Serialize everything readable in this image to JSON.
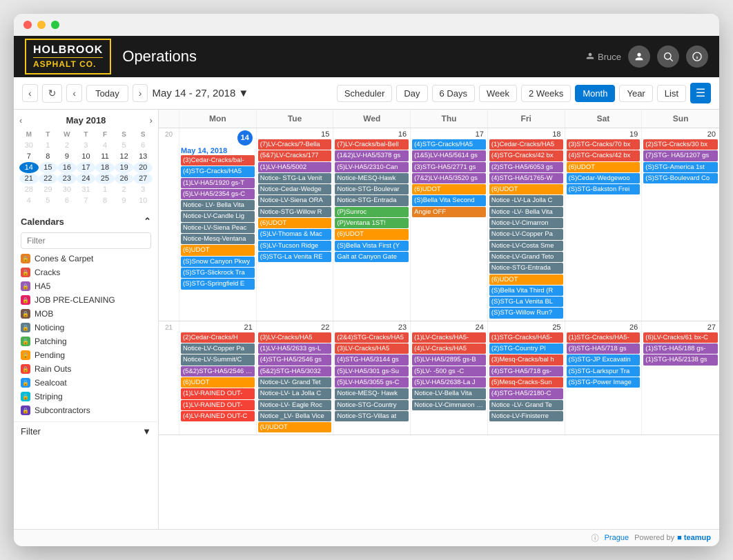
{
  "app": {
    "title": "Operations",
    "logo_line1": "HOLBROOK",
    "logo_line2": "ASPHALT CO.",
    "user_name": "Bruce"
  },
  "toolbar": {
    "today_label": "Today",
    "date_range": "May 14 - 27, 2018",
    "scheduler_label": "Scheduler",
    "day_label": "Day",
    "six_days_label": "6 Days",
    "week_label": "Week",
    "two_weeks_label": "2 Weeks",
    "month_label": "Month",
    "year_label": "Year",
    "list_label": "List"
  },
  "mini_cal": {
    "month_year": "May 2018",
    "days_of_week": [
      "M",
      "T",
      "W",
      "T",
      "F",
      "S",
      "S"
    ],
    "weeks": [
      [
        "30",
        "1",
        "2",
        "3",
        "4",
        "5",
        "6"
      ],
      [
        "7",
        "8",
        "9",
        "10",
        "11",
        "12",
        "13"
      ],
      [
        "14",
        "15",
        "16",
        "17",
        "18",
        "19",
        "20"
      ],
      [
        "21",
        "22",
        "23",
        "24",
        "25",
        "26",
        "27"
      ],
      [
        "28",
        "29",
        "30",
        "31",
        "1",
        "2",
        "3"
      ],
      [
        "4",
        "5",
        "6",
        "7",
        "8",
        "9",
        "10"
      ]
    ]
  },
  "calendars": {
    "header": "Calendars",
    "filter_placeholder": "Filter",
    "items": [
      {
        "label": "Cones & Carpet",
        "color": "#e67e22"
      },
      {
        "label": "Cracks",
        "color": "#e74c3c"
      },
      {
        "label": "HA5",
        "color": "#9b59b6"
      },
      {
        "label": "JOB PRE-CLEANING",
        "color": "#e91e63"
      },
      {
        "label": "MOB",
        "color": "#795548"
      },
      {
        "label": "Noticing",
        "color": "#607d8b"
      },
      {
        "label": "Patching",
        "color": "#4caf50"
      },
      {
        "label": "Pending",
        "color": "#ff9800"
      },
      {
        "label": "Rain Outs",
        "color": "#f44336"
      },
      {
        "label": "Sealcoat",
        "color": "#2196f3"
      },
      {
        "label": "Striping",
        "color": "#00bcd4"
      },
      {
        "label": "Subcontractors",
        "color": "#673ab7"
      }
    ],
    "filter_label": "Filter"
  },
  "calendar": {
    "col_header": "Mon",
    "week_days": [
      "Mon",
      "Tue",
      "Wed",
      "Thu",
      "Fri",
      "Sat",
      "Sun"
    ],
    "weeks": [
      {
        "week_num": 20,
        "days": [
          {
            "date": "14",
            "is_today": true,
            "label": "May 14, 2018",
            "events": [
              {
                "text": "(3)Cedar-Cracks/bal-",
                "color": "#e74c3c"
              },
              {
                "text": "(4)STG-Cracks/HA5",
                "color": "#2196f3"
              },
              {
                "text": "(1)LV-HA5/1920 gs-T",
                "color": "#9b59b6"
              },
              {
                "text": "(5)LV-HA5/2354 gs-C",
                "color": "#9b59b6"
              },
              {
                "text": "Notice- LV- Bella Vita",
                "color": "#607d8b"
              },
              {
                "text": "Notice-LV-Candle Lig",
                "color": "#607d8b"
              },
              {
                "text": "Notice-LV-Siena Peac",
                "color": "#607d8b"
              },
              {
                "text": "Notice-Mesq-Ventana",
                "color": "#607d8b"
              },
              {
                "text": "(6)UDOT",
                "color": "#ff9800"
              },
              {
                "text": "(S)Snow Canyon Pkwy",
                "color": "#2196f3"
              },
              {
                "text": "(S)STG-Slickrock Tra",
                "color": "#2196f3"
              },
              {
                "text": "(S)STG-Springfield E",
                "color": "#2196f3"
              }
            ]
          },
          {
            "date": "15",
            "events": [
              {
                "text": "(7)LV-Cracks/?-Bella",
                "color": "#e74c3c"
              },
              {
                "text": "(5&7)LV-Cracks/177",
                "color": "#e74c3c"
              },
              {
                "text": "(1)LV-HA5/5002",
                "color": "#9b59b6"
              },
              {
                "text": "Notice- STG-La Venit",
                "color": "#607d8b"
              },
              {
                "text": "Notice-Cedar-Wedge",
                "color": "#607d8b"
              },
              {
                "text": "Notice-LV-Siena ORA",
                "color": "#607d8b"
              },
              {
                "text": "Notice-STG-Willow R",
                "color": "#607d8b"
              },
              {
                "text": "(6)UDOT",
                "color": "#ff9800"
              },
              {
                "text": "(S)LV-Thomas & Mac",
                "color": "#2196f3"
              },
              {
                "text": "(S)LV-Tucson Ridge",
                "color": "#2196f3"
              },
              {
                "text": "(S)STG-La Venita RE",
                "color": "#2196f3"
              }
            ]
          },
          {
            "date": "16",
            "events": [
              {
                "text": "(7)LV-Cracks/bal-Bell",
                "color": "#e74c3c"
              },
              {
                "text": "(1&2)LV-HA5/5378 gs",
                "color": "#9b59b6"
              },
              {
                "text": "(5)LV-HA5/2310-Can",
                "color": "#9b59b6"
              },
              {
                "text": "Notice-MESQ-Hawk",
                "color": "#607d8b"
              },
              {
                "text": "Notice-STG-Boulevar",
                "color": "#607d8b"
              },
              {
                "text": "Notice-STG-Entrada",
                "color": "#607d8b"
              },
              {
                "text": "(P)Sunroc",
                "color": "#4caf50"
              },
              {
                "text": "(P)Ventana 1ST!",
                "color": "#4caf50"
              },
              {
                "text": "(6)UDOT",
                "color": "#ff9800"
              },
              {
                "text": "(S)Bella Vista First (Y",
                "color": "#2196f3"
              },
              {
                "text": "Galt at Canyon Gate",
                "color": "#2196f3"
              }
            ]
          },
          {
            "date": "17",
            "events": [
              {
                "text": "(4)STG-Cracks/HA5",
                "color": "#2196f3"
              },
              {
                "text": "(1&5)LV-HA5/5614 gs",
                "color": "#9b59b6"
              },
              {
                "text": "(3)STG-HA5/2771 gs",
                "color": "#9b59b6"
              },
              {
                "text": "(7&2)LV-HA5/3520 gs",
                "color": "#9b59b6"
              },
              {
                "text": "(6)UDOT",
                "color": "#ff9800"
              },
              {
                "text": "(S)Bella Vita Second",
                "color": "#2196f3"
              },
              {
                "text": "Angie OFF",
                "color": "#e67e22"
              }
            ]
          },
          {
            "date": "18",
            "events": [
              {
                "text": "(1)Cedar-Cracks/HA5",
                "color": "#e74c3c"
              },
              {
                "text": "(4)STG-Cracks/42 bx",
                "color": "#e74c3c"
              },
              {
                "text": "(2)STG-HA5/6053 gs",
                "color": "#9b59b6"
              },
              {
                "text": "(4)STG-HA5/1765-W",
                "color": "#9b59b6"
              },
              {
                "text": "(6)UDOT",
                "color": "#ff9800"
              },
              {
                "text": "Notice -LV-La Jolla C",
                "color": "#607d8b"
              },
              {
                "text": "Notice -LV- Bella Vita",
                "color": "#607d8b"
              },
              {
                "text": "Notice-LV-Cimarron",
                "color": "#607d8b"
              },
              {
                "text": "Notice-LV-Copper Pa",
                "color": "#607d8b"
              },
              {
                "text": "Notice-LV-Costa Sme",
                "color": "#607d8b"
              },
              {
                "text": "Notice-LV-Grand Teto",
                "color": "#607d8b"
              },
              {
                "text": "Notice-STG-Entrada",
                "color": "#607d8b"
              },
              {
                "text": "(6)UDOT",
                "color": "#ff9800"
              },
              {
                "text": "(S)Bella Vita Third (R",
                "color": "#2196f3"
              },
              {
                "text": "(S)STG-La Venita BL",
                "color": "#2196f3"
              },
              {
                "text": "(S)STG-Willow Run?",
                "color": "#2196f3"
              }
            ]
          },
          {
            "date": "19",
            "events": [
              {
                "text": "(3)STG-Cracks/70 bx",
                "color": "#e74c3c"
              },
              {
                "text": "(4)STG-Cracks/42 bx",
                "color": "#e74c3c"
              },
              {
                "text": "(6)UDOT",
                "color": "#ff9800"
              },
              {
                "text": "(S)Cedar-Wedgewoo",
                "color": "#2196f3"
              },
              {
                "text": "(S)STG-Bakston Frei",
                "color": "#2196f3"
              }
            ]
          },
          {
            "date": "20",
            "events": [
              {
                "text": "(2)STG-Cracks/30 bx",
                "color": "#e74c3c"
              },
              {
                "text": "(7)STG- HA5/1207 gs",
                "color": "#9b59b6"
              },
              {
                "text": "(S)STG-America 1st",
                "color": "#2196f3"
              },
              {
                "text": "(S)STG-Boulevard Co",
                "color": "#2196f3"
              }
            ]
          }
        ]
      },
      {
        "week_num": 21,
        "days": [
          {
            "date": "21",
            "events": [
              {
                "text": "(2)Cedar-Cracks/H",
                "color": "#e74c3c"
              },
              {
                "text": "Notice-LV-Copper Pa",
                "color": "#607d8b"
              },
              {
                "text": "Notice-LV-Summit/C",
                "color": "#607d8b"
              },
              {
                "text": "(5&2)STG-HA5/2546 gs",
                "color": "#9b59b6"
              },
              {
                "text": "(6)UDOT",
                "color": "#ff9800"
              },
              {
                "text": "(1)LV-RAINED OUT-",
                "color": "#f44336"
              },
              {
                "text": "(1)LV-RAINED OUT-",
                "color": "#f44336"
              },
              {
                "text": "(4)LV-RAINED OUT-C",
                "color": "#f44336"
              }
            ]
          },
          {
            "date": "22",
            "events": [
              {
                "text": "(3)LV-Cracks/HA5",
                "color": "#e74c3c"
              },
              {
                "text": "(1)LV-HA5/2633 gs-L",
                "color": "#9b59b6"
              },
              {
                "text": "(4)STG-HA5/2546 gs",
                "color": "#9b59b6"
              },
              {
                "text": "(5&2)STG-HA5/3032",
                "color": "#9b59b6"
              },
              {
                "text": "Notice-LV- Grand Tet",
                "color": "#607d8b"
              },
              {
                "text": "Notice-LV- La Jolla C",
                "color": "#607d8b"
              },
              {
                "text": "Notice-LV- Eagle Roc",
                "color": "#607d8b"
              },
              {
                "text": "Notice _LV- Bella Vice",
                "color": "#607d8b"
              },
              {
                "text": "(U)UDOT",
                "color": "#ff9800"
              }
            ]
          },
          {
            "date": "23",
            "events": [
              {
                "text": "(2&4)STG-Cracks/HA5",
                "color": "#e74c3c"
              },
              {
                "text": "(3)LV-Cracks/HA5",
                "color": "#e74c3c"
              },
              {
                "text": "(4)STG-HA5/3144 gs",
                "color": "#9b59b6"
              },
              {
                "text": "(5)LV-HA5/301 gs-Su",
                "color": "#9b59b6"
              },
              {
                "text": "(5)LV-HA5/3055 gs-C",
                "color": "#9b59b6"
              },
              {
                "text": "Notice-MESQ- Hawk",
                "color": "#607d8b"
              },
              {
                "text": "Notice-STG-Country",
                "color": "#607d8b"
              },
              {
                "text": "Notice-STG-Villas at",
                "color": "#607d8b"
              }
            ]
          },
          {
            "date": "24",
            "events": [
              {
                "text": "(1)LV-Cracks/HA5-",
                "color": "#e74c3c"
              },
              {
                "text": "(4)LV-Cracks/HA5",
                "color": "#e74c3c"
              },
              {
                "text": "(5)LV-HA5/2895 gs-B",
                "color": "#9b59b6"
              },
              {
                "text": "(5)LV- -500 gs -C",
                "color": "#9b59b6"
              },
              {
                "text": "(5)LV-HA5/2638-La J",
                "color": "#9b59b6"
              },
              {
                "text": "Notice-LV-Bella Vita",
                "color": "#607d8b"
              },
              {
                "text": "Notice-LV-Cimmaron We",
                "color": "#607d8b"
              }
            ]
          },
          {
            "date": "25",
            "events": [
              {
                "text": "(1)STG-Cracks/HA5-",
                "color": "#e74c3c"
              },
              {
                "text": "(2)STG-Country Pl",
                "color": "#2196f3"
              },
              {
                "text": "(3)Mesq-Cracks/bal h",
                "color": "#e74c3c"
              },
              {
                "text": "(4)STG-HA5/718 gs-",
                "color": "#9b59b6"
              },
              {
                "text": "(5)Mesq-Cracks-Sun",
                "color": "#e74c3c"
              },
              {
                "text": "(4)STG-HA5/2180-C",
                "color": "#9b59b6"
              },
              {
                "text": "Notice -LV- Grand Te",
                "color": "#607d8b"
              },
              {
                "text": "Notice-LV-Finisterre",
                "color": "#607d8b"
              }
            ]
          },
          {
            "date": "26",
            "events": [
              {
                "text": "(1)STG-Cracks/HA5-",
                "color": "#e74c3c"
              },
              {
                "text": "(3)STG-HA5/718 gs",
                "color": "#9b59b6"
              },
              {
                "text": "(S)STG-JP Excavatin",
                "color": "#2196f3"
              },
              {
                "text": "(S)STG-Larkspur Tra",
                "color": "#2196f3"
              },
              {
                "text": "(S)STG-Power Image",
                "color": "#2196f3"
              }
            ]
          },
          {
            "date": "27",
            "events": [
              {
                "text": "(6)LV-Cracks/61 bx-C",
                "color": "#e74c3c"
              },
              {
                "text": "(1)STG-HA5/188 gs-",
                "color": "#9b59b6"
              },
              {
                "text": "(1)STG-HA5/2138 gs",
                "color": "#9b59b6"
              }
            ]
          }
        ]
      }
    ]
  },
  "footer": {
    "prague_label": "Prague",
    "powered_label": "Powered by",
    "teamup_label": "teamup"
  }
}
